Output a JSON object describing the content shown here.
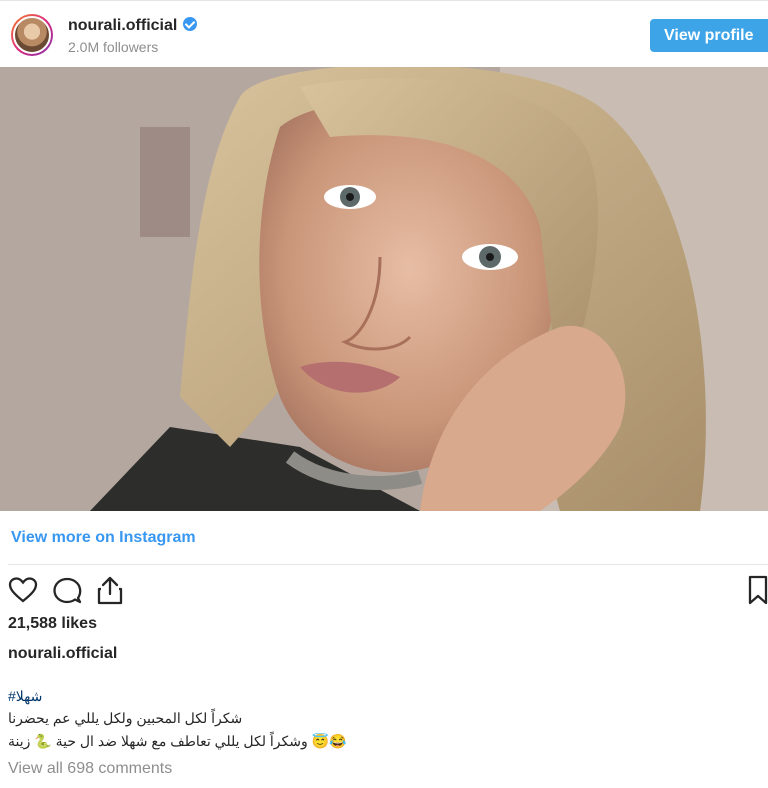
{
  "profile": {
    "username": "nourali.official",
    "followers": "2.0M followers",
    "view_profile_label": "View profile"
  },
  "post": {
    "view_more_label": "View more on Instagram",
    "likes": "21,588 likes",
    "caption_username": "nourali.official",
    "hashtag": "#شهلا",
    "caption_lines": [
      "شكراً لكل المحبين ولكل يللي عم يحضرنا",
      "😂😇 وشكراً لكل يللي تعاطف مع شهلا ضد ال حية 🐍 زينة"
    ],
    "comments_label": "View all 698 comments"
  },
  "icons": [
    "heart-icon",
    "comment-icon",
    "share-icon",
    "bookmark-icon",
    "verified-badge-icon"
  ],
  "colors": {
    "accent": "#3897f0",
    "button": "#3ea4e8",
    "text": "#262626",
    "muted": "#8e8e8e"
  }
}
